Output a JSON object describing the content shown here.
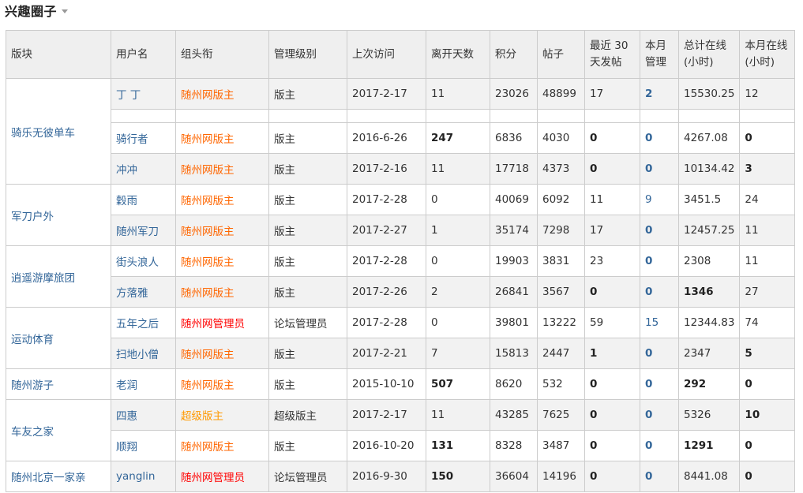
{
  "page": {
    "title": "兴趣圈子"
  },
  "table": {
    "headers": [
      "版块",
      "用户名",
      "组头衔",
      "管理级别",
      "上次访问",
      "离开天数",
      "积分",
      "帖子",
      "最近 30 天发帖",
      "本月管理",
      "总计在线 (小时)",
      "本月在线 (小时)"
    ],
    "sections": [
      {
        "name": "骑乐无彼单车",
        "rows": [
          {
            "user": "丁 丁",
            "title": "随州网版主",
            "title_type": "moderator",
            "level": "版主",
            "last_visit": "2017-2-17",
            "days_away": "11",
            "credits": "23026",
            "posts": "48899",
            "posts_30d": "17",
            "manage_month": "2",
            "online_total": "15530.25",
            "online_month": "12"
          },
          {
            "blank": true
          },
          {
            "user": "骑行者",
            "title": "随州网版主",
            "title_type": "moderator",
            "level": "版主",
            "last_visit": "2016-6-26",
            "days_away": "247",
            "credits": "6836",
            "posts": "4030",
            "posts_30d": "0",
            "manage_month": "0",
            "online_total": "4267.08",
            "online_month": "0"
          },
          {
            "user": "冲冲",
            "title": "随州网版主",
            "title_type": "moderator",
            "level": "版主",
            "last_visit": "2017-2-16",
            "days_away": "11",
            "credits": "17718",
            "posts": "4373",
            "posts_30d": "0",
            "manage_month": "0",
            "online_total": "10134.42",
            "online_month": "3"
          }
        ]
      },
      {
        "name": "军刀户外",
        "rows": [
          {
            "user": "穀雨",
            "title": "随州网版主",
            "title_type": "moderator",
            "level": "版主",
            "last_visit": "2017-2-28",
            "days_away": "0",
            "credits": "40069",
            "posts": "6092",
            "posts_30d": "11",
            "manage_month": "9",
            "online_total": "3451.5",
            "online_month": "24"
          },
          {
            "user": "随州军刀",
            "title": "随州网版主",
            "title_type": "moderator",
            "level": "版主",
            "last_visit": "2017-2-27",
            "days_away": "1",
            "credits": "35174",
            "posts": "7298",
            "posts_30d": "17",
            "manage_month": "0",
            "online_total": "12457.25",
            "online_month": "11"
          }
        ]
      },
      {
        "name": "逍遥游摩旅团",
        "rows": [
          {
            "user": "街头浪人",
            "title": "随州网版主",
            "title_type": "moderator",
            "level": "版主",
            "last_visit": "2017-2-28",
            "days_away": "0",
            "credits": "19903",
            "posts": "3831",
            "posts_30d": "23",
            "manage_month": "0",
            "online_total": "2308",
            "online_month": "11"
          },
          {
            "user": "方落雅",
            "title": "随州网版主",
            "title_type": "moderator",
            "level": "版主",
            "last_visit": "2017-2-26",
            "days_away": "2",
            "credits": "26841",
            "posts": "3567",
            "posts_30d": "0",
            "manage_month": "0",
            "online_total": "1346",
            "online_month": "27"
          }
        ]
      },
      {
        "name": "运动体育",
        "rows": [
          {
            "user": "五年之后",
            "title": "随州网管理员",
            "title_type": "admin",
            "level": "论坛管理员",
            "last_visit": "2017-2-28",
            "days_away": "0",
            "credits": "39801",
            "posts": "13222",
            "posts_30d": "59",
            "manage_month": "15",
            "online_total": "12344.83",
            "online_month": "74"
          },
          {
            "user": "扫地小僧",
            "title": "随州网版主",
            "title_type": "moderator",
            "level": "版主",
            "last_visit": "2017-2-21",
            "days_away": "7",
            "credits": "15813",
            "posts": "2447",
            "posts_30d": "1",
            "manage_month": "0",
            "online_total": "2347",
            "online_month": "5"
          }
        ]
      },
      {
        "name": "随州游子",
        "rows": [
          {
            "user": "老润",
            "title": "随州网版主",
            "title_type": "moderator",
            "level": "版主",
            "last_visit": "2015-10-10",
            "days_away": "507",
            "credits": "8620",
            "posts": "532",
            "posts_30d": "0",
            "manage_month": "0",
            "online_total": "292",
            "online_month": "0"
          }
        ]
      },
      {
        "name": "车友之家",
        "rows": [
          {
            "user": "四惠",
            "title": "超级版主",
            "title_type": "super",
            "level": "超级版主",
            "last_visit": "2017-2-17",
            "days_away": "11",
            "credits": "43285",
            "posts": "7625",
            "posts_30d": "0",
            "manage_month": "0",
            "online_total": "5326",
            "online_month": "10"
          },
          {
            "user": "顺翔",
            "title": "随州网版主",
            "title_type": "moderator",
            "level": "版主",
            "last_visit": "2016-10-20",
            "days_away": "131",
            "credits": "8328",
            "posts": "3487",
            "posts_30d": "0",
            "manage_month": "0",
            "online_total": "1291",
            "online_month": "0"
          }
        ]
      },
      {
        "name": "随州北京一家亲",
        "rows": [
          {
            "user": "yanglin",
            "title": "随州网管理员",
            "title_type": "admin",
            "level": "论坛管理员",
            "last_visit": "2016-9-30",
            "days_away": "150",
            "credits": "36604",
            "posts": "14196",
            "posts_30d": "0",
            "manage_month": "0",
            "online_total": "8441.08",
            "online_month": "0"
          }
        ]
      }
    ]
  },
  "colors": {
    "link": "#336699",
    "moderator": "#ff6600",
    "admin": "#ff0000",
    "super": "#ff9900"
  }
}
